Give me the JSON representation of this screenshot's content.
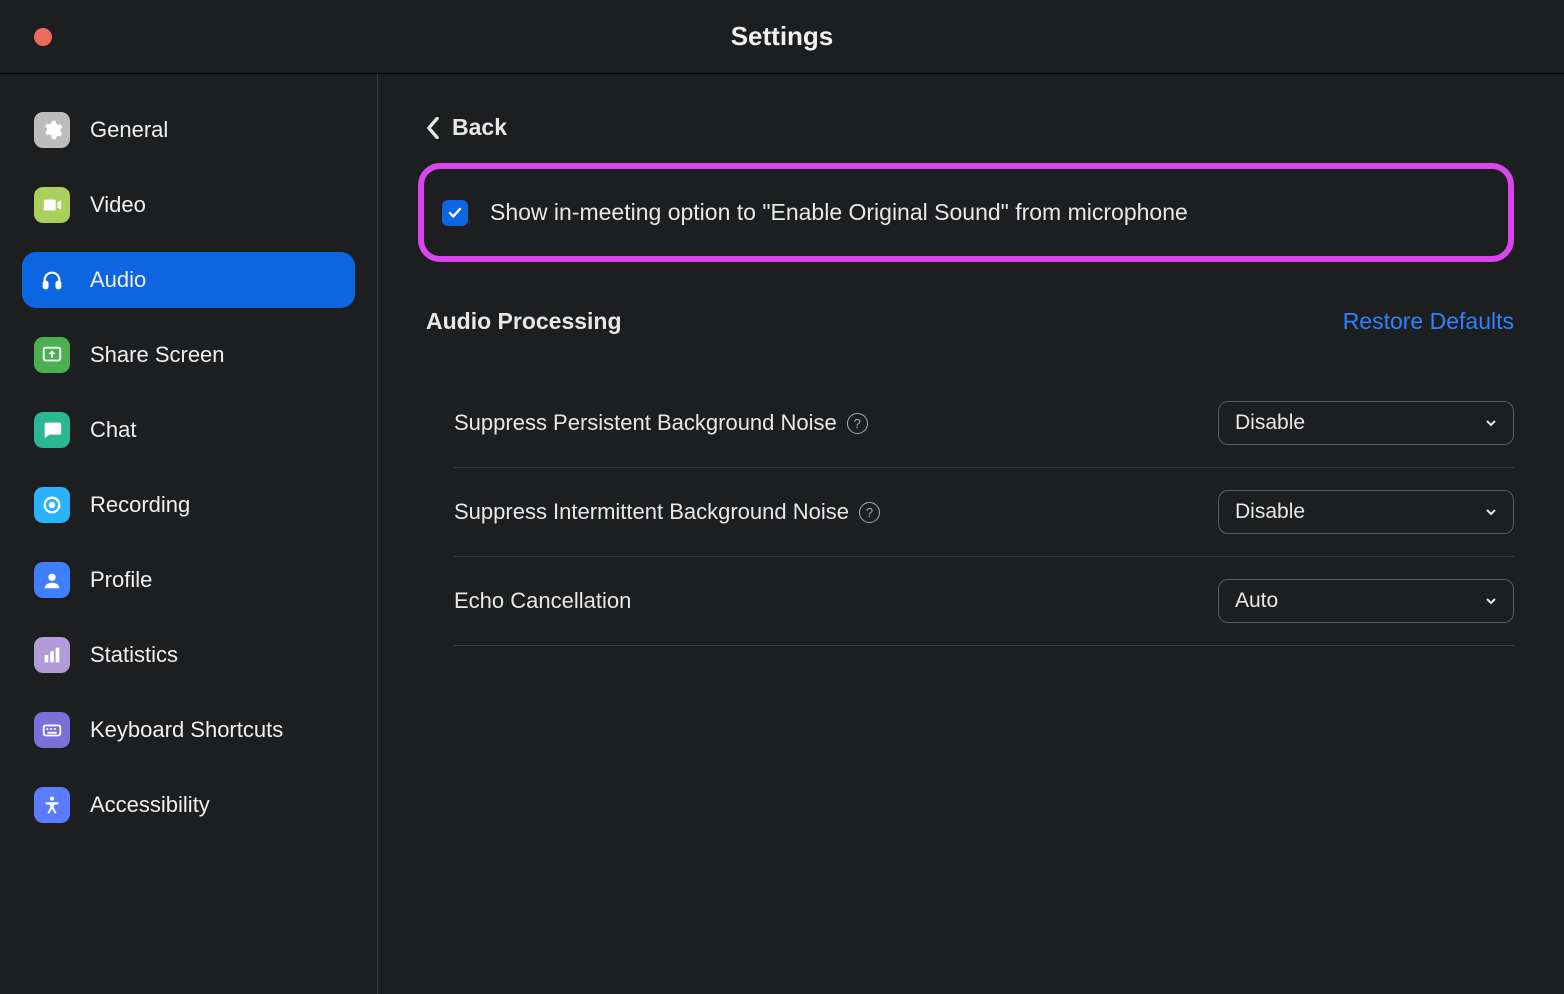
{
  "window": {
    "title": "Settings"
  },
  "sidebar": {
    "items": [
      {
        "label": "General"
      },
      {
        "label": "Video"
      },
      {
        "label": "Audio"
      },
      {
        "label": "Share Screen"
      },
      {
        "label": "Chat"
      },
      {
        "label": "Recording"
      },
      {
        "label": "Profile"
      },
      {
        "label": "Statistics"
      },
      {
        "label": "Keyboard Shortcuts"
      },
      {
        "label": "Accessibility"
      }
    ],
    "active_index": 2
  },
  "main": {
    "back_label": "Back",
    "original_sound_checkbox": {
      "checked": true,
      "label": "Show in-meeting option to \"Enable Original Sound\" from microphone"
    },
    "section_title": "Audio Processing",
    "restore_label": "Restore Defaults",
    "settings": [
      {
        "label": "Suppress Persistent Background Noise",
        "help": true,
        "value": "Disable"
      },
      {
        "label": "Suppress Intermittent Background Noise",
        "help": true,
        "value": "Disable"
      },
      {
        "label": "Echo Cancellation",
        "help": false,
        "value": "Auto"
      }
    ]
  }
}
